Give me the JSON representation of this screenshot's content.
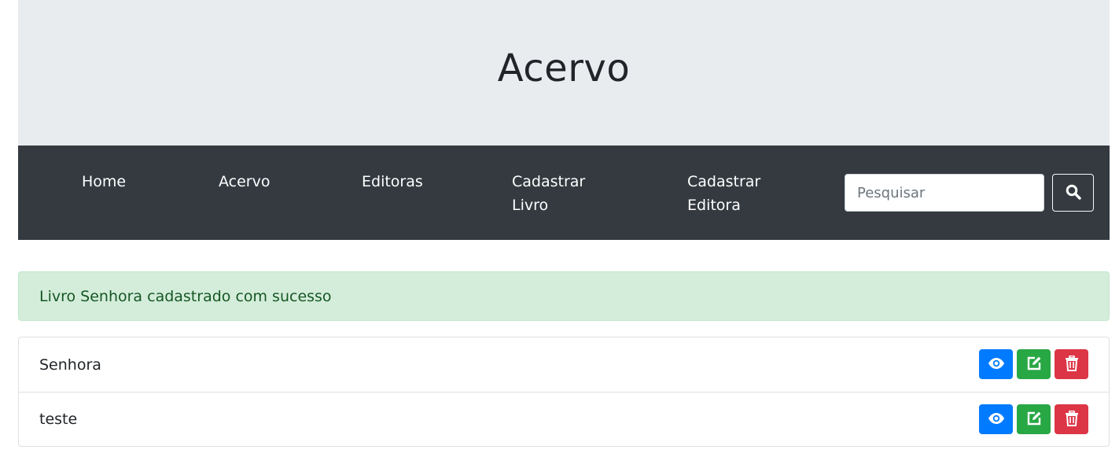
{
  "header": {
    "title": "Acervo"
  },
  "nav": {
    "items": [
      {
        "label": "Home"
      },
      {
        "label": "Acervo"
      },
      {
        "label": "Editoras"
      },
      {
        "label": "Cadastrar",
        "label2": "Livro"
      },
      {
        "label": "Cadastrar",
        "label2": "Editora"
      }
    ],
    "search": {
      "placeholder": "Pesquisar",
      "value": "",
      "icon": "search-icon"
    }
  },
  "alert": {
    "message": "Livro Senhora cadastrado com sucesso",
    "color": "#d4edda"
  },
  "books": [
    {
      "title": "Senhora"
    },
    {
      "title": "teste"
    }
  ],
  "actions": {
    "view_icon": "eye-icon",
    "view_color": "#007bff",
    "edit_icon": "edit-icon",
    "edit_color": "#28a745",
    "delete_icon": "trash-icon",
    "delete_color": "#dc3545"
  }
}
